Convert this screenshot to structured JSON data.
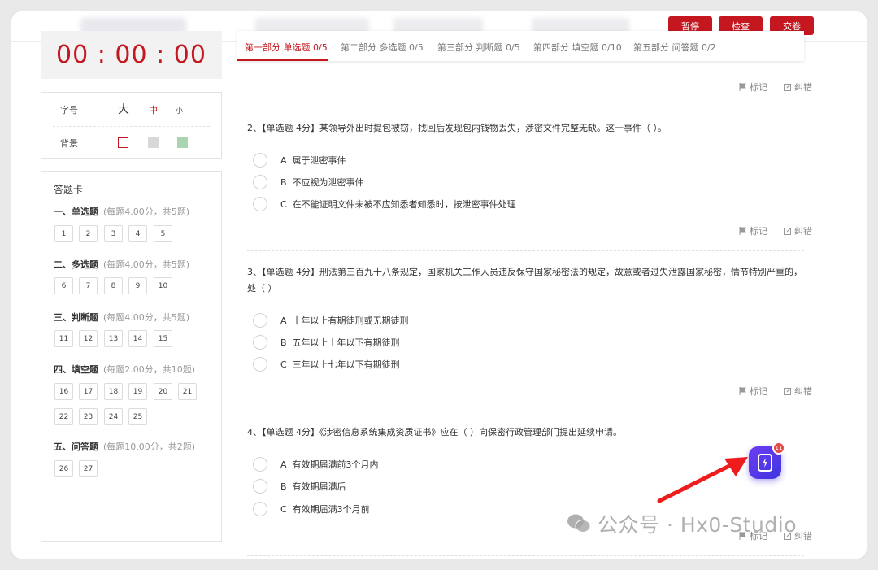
{
  "toolbar": {
    "pause_label": "暂停",
    "check_label": "检查",
    "submit_label": "交卷",
    "accent": "#c4171f"
  },
  "timer": "00 : 00 : 00",
  "settings": {
    "font_label": "字号",
    "font_options": [
      "大",
      "中",
      "小"
    ],
    "font_selected": "中",
    "bg_label": "背景",
    "bg_swatches": [
      "#ffffff",
      "#d8d8d8",
      "#a8d5b0"
    ]
  },
  "answer_card": {
    "title": "答题卡",
    "sections": [
      {
        "name": "一、单选题",
        "note": "(每题4.00分，共5题)",
        "numbers": [
          "1",
          "2",
          "3",
          "4",
          "5"
        ]
      },
      {
        "name": "二、多选题",
        "note": "(每题4.00分，共5题)",
        "numbers": [
          "6",
          "7",
          "8",
          "9",
          "10"
        ]
      },
      {
        "name": "三、判断题",
        "note": "(每题4.00分，共5题)",
        "numbers": [
          "11",
          "12",
          "13",
          "14",
          "15"
        ]
      },
      {
        "name": "四、填空题",
        "note": "(每题2.00分，共10题)",
        "numbers": [
          "16",
          "17",
          "18",
          "19",
          "20",
          "21",
          "22",
          "23",
          "24",
          "25"
        ]
      },
      {
        "name": "五、问答题",
        "note": "(每题10.00分，共2题)",
        "numbers": [
          "26",
          "27"
        ]
      }
    ]
  },
  "tabs": [
    {
      "label": "第一部分 单选题 0/5",
      "active": true
    },
    {
      "label": "第二部分 多选题 0/5",
      "active": false
    },
    {
      "label": "第三部分 判断题 0/5",
      "active": false
    },
    {
      "label": "第四部分 填空题 0/10",
      "active": false
    },
    {
      "label": "第五部分 问答题 0/2",
      "active": false
    }
  ],
  "actions": {
    "mark_label": "标记",
    "report_label": "纠错"
  },
  "questions": [
    {
      "text": "2、【单选题 4分】某领导外出时提包被窃，找回后发现包内钱物丢失，涉密文件完整无缺。这一事件（ ）。",
      "options": [
        {
          "letter": "A",
          "text": "属于泄密事件"
        },
        {
          "letter": "B",
          "text": "不应视为泄密事件"
        },
        {
          "letter": "C",
          "text": "在不能证明文件未被不应知悉者知悉时，按泄密事件处理"
        }
      ]
    },
    {
      "text": "3、【单选题 4分】刑法第三百九十八条规定，国家机关工作人员违反保守国家秘密法的规定，故意或者过失泄露国家秘密，情节特别严重的，处（ ）",
      "options": [
        {
          "letter": "A",
          "text": "十年以上有期徒刑或无期徒刑"
        },
        {
          "letter": "B",
          "text": "五年以上十年以下有期徒刑"
        },
        {
          "letter": "C",
          "text": "三年以上七年以下有期徒刑"
        }
      ]
    },
    {
      "text": "4、【单选题 4分】《涉密信息系统集成资质证书》应在（ ）向保密行政管理部门提出延续申请。",
      "options": [
        {
          "letter": "A",
          "text": "有效期届满前3个月内"
        },
        {
          "letter": "B",
          "text": "有效期届满后"
        },
        {
          "letter": "C",
          "text": "有效期届满3个月前"
        }
      ]
    }
  ],
  "fab": {
    "badge": "11",
    "icon": "lightning-icon"
  },
  "watermark": "公众号 · Hx0-Studio"
}
